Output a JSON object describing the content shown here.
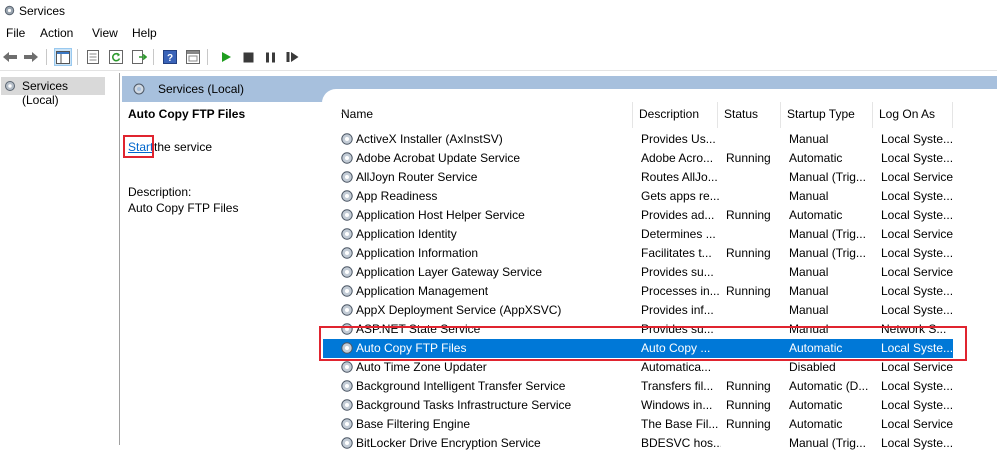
{
  "window": {
    "title": "Services"
  },
  "menu": [
    "File",
    "Action",
    "View",
    "Help"
  ],
  "toolbar": {
    "buttons": [
      "back-icon",
      "forward-icon",
      "show-hide-tree-icon",
      "properties-icon",
      "refresh-icon",
      "export-list-icon",
      "help-icon",
      "console-icon",
      "play-icon",
      "stop-icon",
      "pause-icon",
      "restart-icon"
    ]
  },
  "tree": {
    "root_label": "Services (Local)"
  },
  "pane": {
    "header": "Services (Local)",
    "selected_name": "Auto Copy FTP Files",
    "start_link": "Start",
    "start_rest": " the service",
    "description_label": "Description:",
    "description_value": "Auto Copy FTP Files"
  },
  "columns": [
    "Name",
    "Description",
    "Status",
    "Startup Type",
    "Log On As"
  ],
  "rows": [
    [
      "ActiveX Installer (AxInstSV)",
      "Provides Us...",
      "",
      "Manual",
      "Local Syste..."
    ],
    [
      "Adobe Acrobat Update Service",
      "Adobe Acro...",
      "Running",
      "Automatic",
      "Local Syste..."
    ],
    [
      "AllJoyn Router Service",
      "Routes AllJo...",
      "",
      "Manual (Trig...",
      "Local Service"
    ],
    [
      "App Readiness",
      "Gets apps re...",
      "",
      "Manual",
      "Local Syste..."
    ],
    [
      "Application Host Helper Service",
      "Provides ad...",
      "Running",
      "Automatic",
      "Local Syste..."
    ],
    [
      "Application Identity",
      "Determines ...",
      "",
      "Manual (Trig...",
      "Local Service"
    ],
    [
      "Application Information",
      "Facilitates t...",
      "Running",
      "Manual (Trig...",
      "Local Syste..."
    ],
    [
      "Application Layer Gateway Service",
      "Provides su...",
      "",
      "Manual",
      "Local Service"
    ],
    [
      "Application Management",
      "Processes in...",
      "Running",
      "Manual",
      "Local Syste..."
    ],
    [
      "AppX Deployment Service (AppXSVC)",
      "Provides inf...",
      "",
      "Manual",
      "Local Syste..."
    ],
    [
      "ASP.NET State Service",
      "Provides su...",
      "",
      "Manual",
      "Network S..."
    ],
    [
      "Auto Copy FTP Files",
      "Auto Copy ...",
      "",
      "Automatic",
      "Local Syste..."
    ],
    [
      "Auto Time Zone Updater",
      "Automatica...",
      "",
      "Disabled",
      "Local Service"
    ],
    [
      "Background Intelligent Transfer Service",
      "Transfers fil...",
      "Running",
      "Automatic (D...",
      "Local Syste..."
    ],
    [
      "Background Tasks Infrastructure Service",
      "Windows in...",
      "Running",
      "Automatic",
      "Local Syste..."
    ],
    [
      "Base Filtering Engine",
      "The Base Fil...",
      "Running",
      "Automatic",
      "Local Service"
    ],
    [
      "BitLocker Drive Encryption Service",
      "BDESVC hos...",
      "",
      "Manual (Trig...",
      "Local Syste..."
    ]
  ],
  "selected_row": 11,
  "colors": {
    "selection": "#0078d7",
    "header_band": "#a7c0dd",
    "highlight_box": "#e0242f",
    "link": "#0066cc"
  }
}
